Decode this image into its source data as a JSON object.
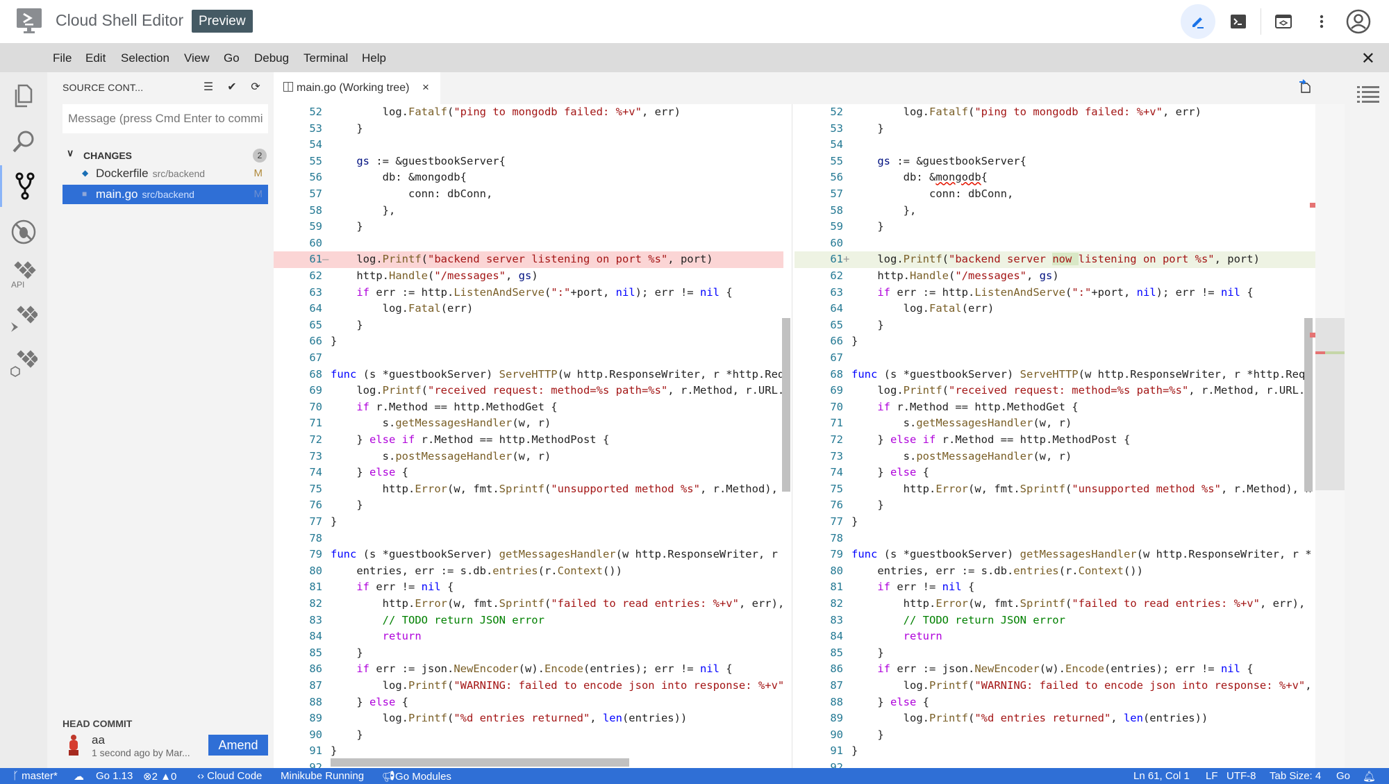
{
  "app": {
    "title": "Cloud Shell Editor",
    "badge": "Preview",
    "top_icons": [
      "edit-pencil-icon",
      "terminal-icon",
      "web-preview-icon",
      "more-vert-icon",
      "account-icon"
    ]
  },
  "menu": {
    "items": [
      "File",
      "Edit",
      "Selection",
      "View",
      "Go",
      "Debug",
      "Terminal",
      "Help"
    ],
    "close_label": "✕"
  },
  "activity_bar": [
    "explorer-icon",
    "search-icon",
    "source-control-icon",
    "no-debug-icon",
    "cloud-api-icon",
    "cloud-run-icon",
    "cloud-gke-icon"
  ],
  "sidebar": {
    "title": "SOURCE CONT...",
    "actions": [
      "tree-view",
      "commit",
      "refresh",
      "open-changes",
      "more"
    ],
    "commit_placeholder": "Message (press Cmd Enter to commit",
    "changes_label": "CHANGES",
    "changes_count": "2",
    "files": [
      {
        "name": "Dockerfile",
        "path": "src/backend",
        "status": "M",
        "selected": false
      },
      {
        "name": "main.go",
        "path": "src/backend",
        "status": "M",
        "selected": true
      }
    ],
    "head_commit": {
      "label": "HEAD COMMIT",
      "message": "aa",
      "meta": "1 second ago by Mar...",
      "amend_label": "Amend"
    }
  },
  "editor": {
    "tab_label": "main.go (Working tree)",
    "tab_close": "×",
    "left_lines": [
      {
        "n": "52",
        "t": "        log.Fatalf(\"ping to mongodb failed: %+v\", err)"
      },
      {
        "n": "53",
        "t": "    }"
      },
      {
        "n": "54",
        "t": ""
      },
      {
        "n": "55",
        "t": "    gs := &guestbookServer{"
      },
      {
        "n": "56",
        "t": "        db: &mongodb{"
      },
      {
        "n": "57",
        "t": "            conn: dbConn,"
      },
      {
        "n": "58",
        "t": "        },"
      },
      {
        "n": "59",
        "t": "    }"
      },
      {
        "n": "60",
        "t": ""
      },
      {
        "n": "61",
        "t": "    log.Printf(\"backend server listening on port %s\", port)",
        "type": "del"
      },
      {
        "n": "62",
        "t": "    http.Handle(\"/messages\", gs)"
      },
      {
        "n": "63",
        "t": "    if err := http.ListenAndServe(\":\"+port, nil); err != nil {"
      },
      {
        "n": "64",
        "t": "        log.Fatal(err)"
      },
      {
        "n": "65",
        "t": "    }"
      },
      {
        "n": "66",
        "t": "}"
      },
      {
        "n": "67",
        "t": ""
      },
      {
        "n": "68",
        "t": "func (s *guestbookServer) ServeHTTP(w http.ResponseWriter, r *http.Requ"
      },
      {
        "n": "69",
        "t": "    log.Printf(\"received request: method=%s path=%s\", r.Method, r.URL.P"
      },
      {
        "n": "70",
        "t": "    if r.Method == http.MethodGet {"
      },
      {
        "n": "71",
        "t": "        s.getMessagesHandler(w, r)"
      },
      {
        "n": "72",
        "t": "    } else if r.Method == http.MethodPost {"
      },
      {
        "n": "73",
        "t": "        s.postMessageHandler(w, r)"
      },
      {
        "n": "74",
        "t": "    } else {"
      },
      {
        "n": "75",
        "t": "        http.Error(w, fmt.Sprintf(\"unsupported method %s\", r.Method), h"
      },
      {
        "n": "76",
        "t": "    }"
      },
      {
        "n": "77",
        "t": "}"
      },
      {
        "n": "78",
        "t": ""
      },
      {
        "n": "79",
        "t": "func (s *guestbookServer) getMessagesHandler(w http.ResponseWriter, r *"
      },
      {
        "n": "80",
        "t": "    entries, err := s.db.entries(r.Context())"
      },
      {
        "n": "81",
        "t": "    if err != nil {"
      },
      {
        "n": "82",
        "t": "        http.Error(w, fmt.Sprintf(\"failed to read entries: %+v\", err),"
      },
      {
        "n": "83",
        "t": "        // TODO return JSON error"
      },
      {
        "n": "84",
        "t": "        return"
      },
      {
        "n": "85",
        "t": "    }"
      },
      {
        "n": "86",
        "t": "    if err := json.NewEncoder(w).Encode(entries); err != nil {"
      },
      {
        "n": "87",
        "t": "        log.Printf(\"WARNING: failed to encode json into response: %+v\","
      },
      {
        "n": "88",
        "t": "    } else {"
      },
      {
        "n": "89",
        "t": "        log.Printf(\"%d entries returned\", len(entries))"
      },
      {
        "n": "90",
        "t": "    }"
      },
      {
        "n": "91",
        "t": "}"
      },
      {
        "n": "92",
        "t": ""
      }
    ],
    "right_lines": [
      {
        "n": "52",
        "t": "        log.Fatalf(\"ping to mongodb failed: %+v\", err)"
      },
      {
        "n": "53",
        "t": "    }"
      },
      {
        "n": "54",
        "t": ""
      },
      {
        "n": "55",
        "t": "    gs := &guestbookServer{"
      },
      {
        "n": "56",
        "t": "        db: &mongodb{"
      },
      {
        "n": "57",
        "t": "            conn: dbConn,"
      },
      {
        "n": "58",
        "t": "        },"
      },
      {
        "n": "59",
        "t": "    }"
      },
      {
        "n": "60",
        "t": ""
      },
      {
        "n": "61",
        "t": "    log.Printf(\"backend server now listening on port %s\", port)",
        "type": "add"
      },
      {
        "n": "62",
        "t": "    http.Handle(\"/messages\", gs)"
      },
      {
        "n": "63",
        "t": "    if err := http.ListenAndServe(\":\"+port, nil); err != nil {"
      },
      {
        "n": "64",
        "t": "        log.Fatal(err)"
      },
      {
        "n": "65",
        "t": "    }"
      },
      {
        "n": "66",
        "t": "}"
      },
      {
        "n": "67",
        "t": ""
      },
      {
        "n": "68",
        "t": "func (s *guestbookServer) ServeHTTP(w http.ResponseWriter, r *http.Requ"
      },
      {
        "n": "69",
        "t": "    log.Printf(\"received request: method=%s path=%s\", r.Method, r.URL.P"
      },
      {
        "n": "70",
        "t": "    if r.Method == http.MethodGet {"
      },
      {
        "n": "71",
        "t": "        s.getMessagesHandler(w, r)"
      },
      {
        "n": "72",
        "t": "    } else if r.Method == http.MethodPost {"
      },
      {
        "n": "73",
        "t": "        s.postMessageHandler(w, r)"
      },
      {
        "n": "74",
        "t": "    } else {"
      },
      {
        "n": "75",
        "t": "        http.Error(w, fmt.Sprintf(\"unsupported method %s\", r.Method), h"
      },
      {
        "n": "76",
        "t": "    }"
      },
      {
        "n": "77",
        "t": "}"
      },
      {
        "n": "78",
        "t": ""
      },
      {
        "n": "79",
        "t": "func (s *guestbookServer) getMessagesHandler(w http.ResponseWriter, r *"
      },
      {
        "n": "80",
        "t": "    entries, err := s.db.entries(r.Context())"
      },
      {
        "n": "81",
        "t": "    if err != nil {"
      },
      {
        "n": "82",
        "t": "        http.Error(w, fmt.Sprintf(\"failed to read entries: %+v\", err),"
      },
      {
        "n": "83",
        "t": "        // TODO return JSON error"
      },
      {
        "n": "84",
        "t": "        return"
      },
      {
        "n": "85",
        "t": "    }"
      },
      {
        "n": "86",
        "t": "    if err := json.NewEncoder(w).Encode(entries); err != nil {"
      },
      {
        "n": "87",
        "t": "        log.Printf(\"WARNING: failed to encode json into response: %+v\","
      },
      {
        "n": "88",
        "t": "    } else {"
      },
      {
        "n": "89",
        "t": "        log.Printf(\"%d entries returned\", len(entries))"
      },
      {
        "n": "90",
        "t": "    }"
      },
      {
        "n": "91",
        "t": "}"
      },
      {
        "n": "92",
        "t": ""
      }
    ],
    "del_marker": "—",
    "add_marker": "+"
  },
  "status_bar": {
    "branch": "master*",
    "go_version": "Go 1.13",
    "errors": "2",
    "warnings": "0",
    "cloud_code": "Cloud Code",
    "minikube": "Minikube Running",
    "go_modules": "Go Modules",
    "cursor": "Ln 61, Col 1",
    "eol": "LF",
    "encoding": "UTF-8",
    "tab_size": "Tab Size: 4",
    "language": "Go"
  },
  "colors": {
    "accent": "#2f6fd6",
    "deleted_line": "#fbd5d5",
    "added_line": "#eef3e3",
    "badge": "#455a64"
  }
}
